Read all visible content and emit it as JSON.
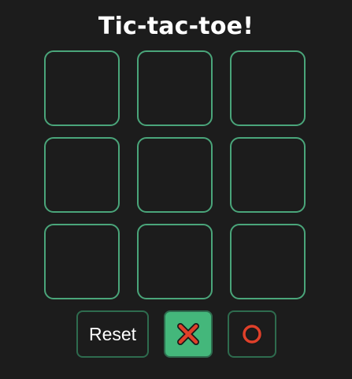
{
  "title": "Tic-tac-toe!",
  "board": {
    "cells": [
      "",
      "",
      "",
      "",
      "",
      "",
      "",
      "",
      ""
    ]
  },
  "controls": {
    "reset_label": "Reset",
    "x_icon": "x-mark-icon",
    "o_icon": "o-mark-icon",
    "selected_player": "X"
  },
  "colors": {
    "background": "#1c1c1c",
    "cell_border": "#4aa57a",
    "selected_button": "#44b77b",
    "mark_red": "#e0402a"
  }
}
